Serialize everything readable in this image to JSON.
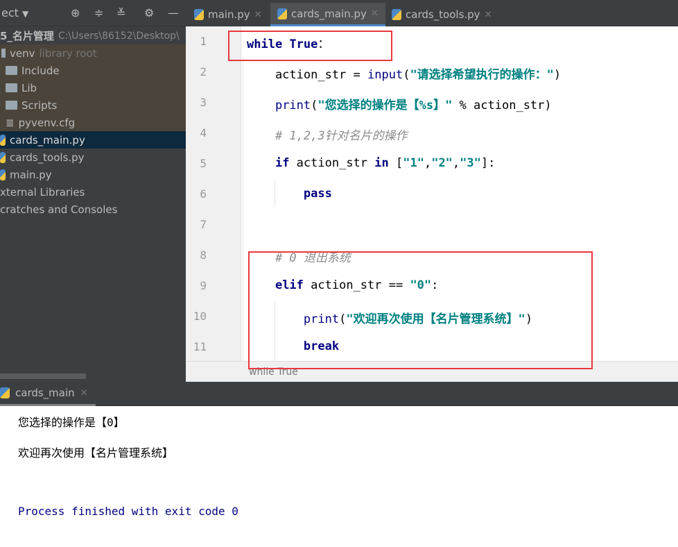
{
  "toolbar": {
    "project_label": "ect",
    "tabs": [
      {
        "label": "main.py",
        "active": false
      },
      {
        "label": "cards_main.py",
        "active": true
      },
      {
        "label": "cards_tools.py",
        "active": false
      }
    ]
  },
  "project": {
    "root": "5_名片管理",
    "root_path": "C:\\Users\\86152\\Desktop\\",
    "items": [
      {
        "label": "venv",
        "hint": "library root"
      },
      {
        "label": "Include"
      },
      {
        "label": "Lib"
      },
      {
        "label": "Scripts"
      },
      {
        "label": "pyvenv.cfg"
      },
      {
        "label": "cards_main.py",
        "selected": true
      },
      {
        "label": "cards_tools.py"
      },
      {
        "label": "main.py"
      },
      {
        "label": "xternal Libraries"
      },
      {
        "label": "cratches and Consoles"
      }
    ]
  },
  "editor": {
    "lines": [
      [
        [
          "kw",
          "while True"
        ],
        [
          "",
          "："
        ]
      ],
      [
        [
          "",
          "    action_str = "
        ],
        [
          "bi",
          "input"
        ],
        [
          "",
          "("
        ],
        [
          "st",
          "\"请选择希望执行的操作：\""
        ],
        [
          "",
          ")"
        ]
      ],
      [
        [
          "",
          "    "
        ],
        [
          "bi",
          "print"
        ],
        [
          "",
          "("
        ],
        [
          "st",
          "\"您选择的操作是【%s】\""
        ],
        [
          "",
          " % action_str)"
        ]
      ],
      [
        [
          "cm",
          "    # 1,2,3针对名片的操作"
        ]
      ],
      [
        [
          "",
          "    "
        ],
        [
          "kw",
          "if"
        ],
        [
          "",
          " action_str "
        ],
        [
          "kw",
          "in"
        ],
        [
          "",
          " ["
        ],
        [
          "st",
          "\"1\""
        ],
        [
          "",
          ","
        ],
        [
          "st",
          "\"2\""
        ],
        [
          "",
          ","
        ],
        [
          "st",
          "\"3\""
        ],
        [
          "",
          "]:"
        ]
      ],
      [
        [
          "",
          "        "
        ],
        [
          "kw",
          "pass"
        ]
      ],
      [
        [
          "",
          ""
        ]
      ],
      [
        [
          "cm",
          "    # 0 退出系统"
        ]
      ],
      [
        [
          "",
          "    "
        ],
        [
          "kw",
          "elif"
        ],
        [
          "",
          " action_str == "
        ],
        [
          "st",
          "\"0\""
        ],
        [
          "",
          ":"
        ]
      ],
      [
        [
          "",
          "        "
        ],
        [
          "bi",
          "print"
        ],
        [
          "",
          "("
        ],
        [
          "st",
          "\"欢迎再次使用【名片管理系统】\""
        ],
        [
          "",
          ")"
        ]
      ],
      [
        [
          "",
          "        "
        ],
        [
          "kw",
          "break"
        ]
      ]
    ],
    "breadcrumb": "while True"
  },
  "run": {
    "tab": "cards_main",
    "output": [
      "您选择的操作是【0】",
      "欢迎再次使用【名片管理系统】",
      "",
      "Process finished with exit code 0"
    ]
  }
}
